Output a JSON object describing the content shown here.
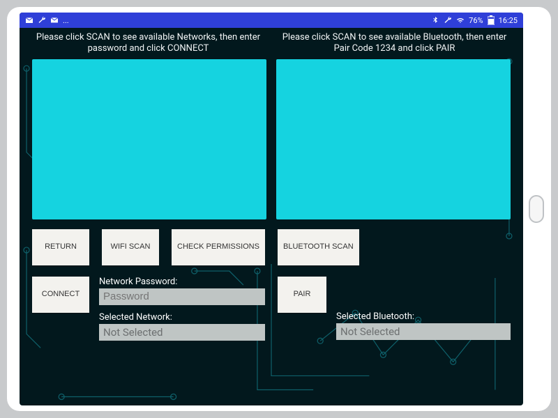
{
  "statusbar": {
    "left_ellipsis": "...",
    "battery_text": "76%",
    "clock": "16:25"
  },
  "wifi": {
    "instruction": "Please click SCAN to see available Networks, then enter password and click CONNECT",
    "return_label": "RETURN",
    "scan_label": "WIFI SCAN",
    "check_perm_label": "CHECK PERMISSIONS",
    "connect_label": "CONNECT",
    "password_label": "Network Password:",
    "password_placeholder": "Password",
    "password_value": "",
    "selected_label": "Selected Network:",
    "selected_value": "Not Selected"
  },
  "bt": {
    "instruction": "Please click SCAN to see available Bluetooth, then enter Pair Code 1234 and click PAIR",
    "scan_label": "BLUETOOTH SCAN",
    "pair_label": "PAIR",
    "selected_label": "Selected Bluetooth:",
    "selected_value": "Not Selected"
  },
  "colors": {
    "panel": "#15d3e0",
    "statusbar": "#2f3fd8",
    "screen_bg": "#02181d"
  }
}
